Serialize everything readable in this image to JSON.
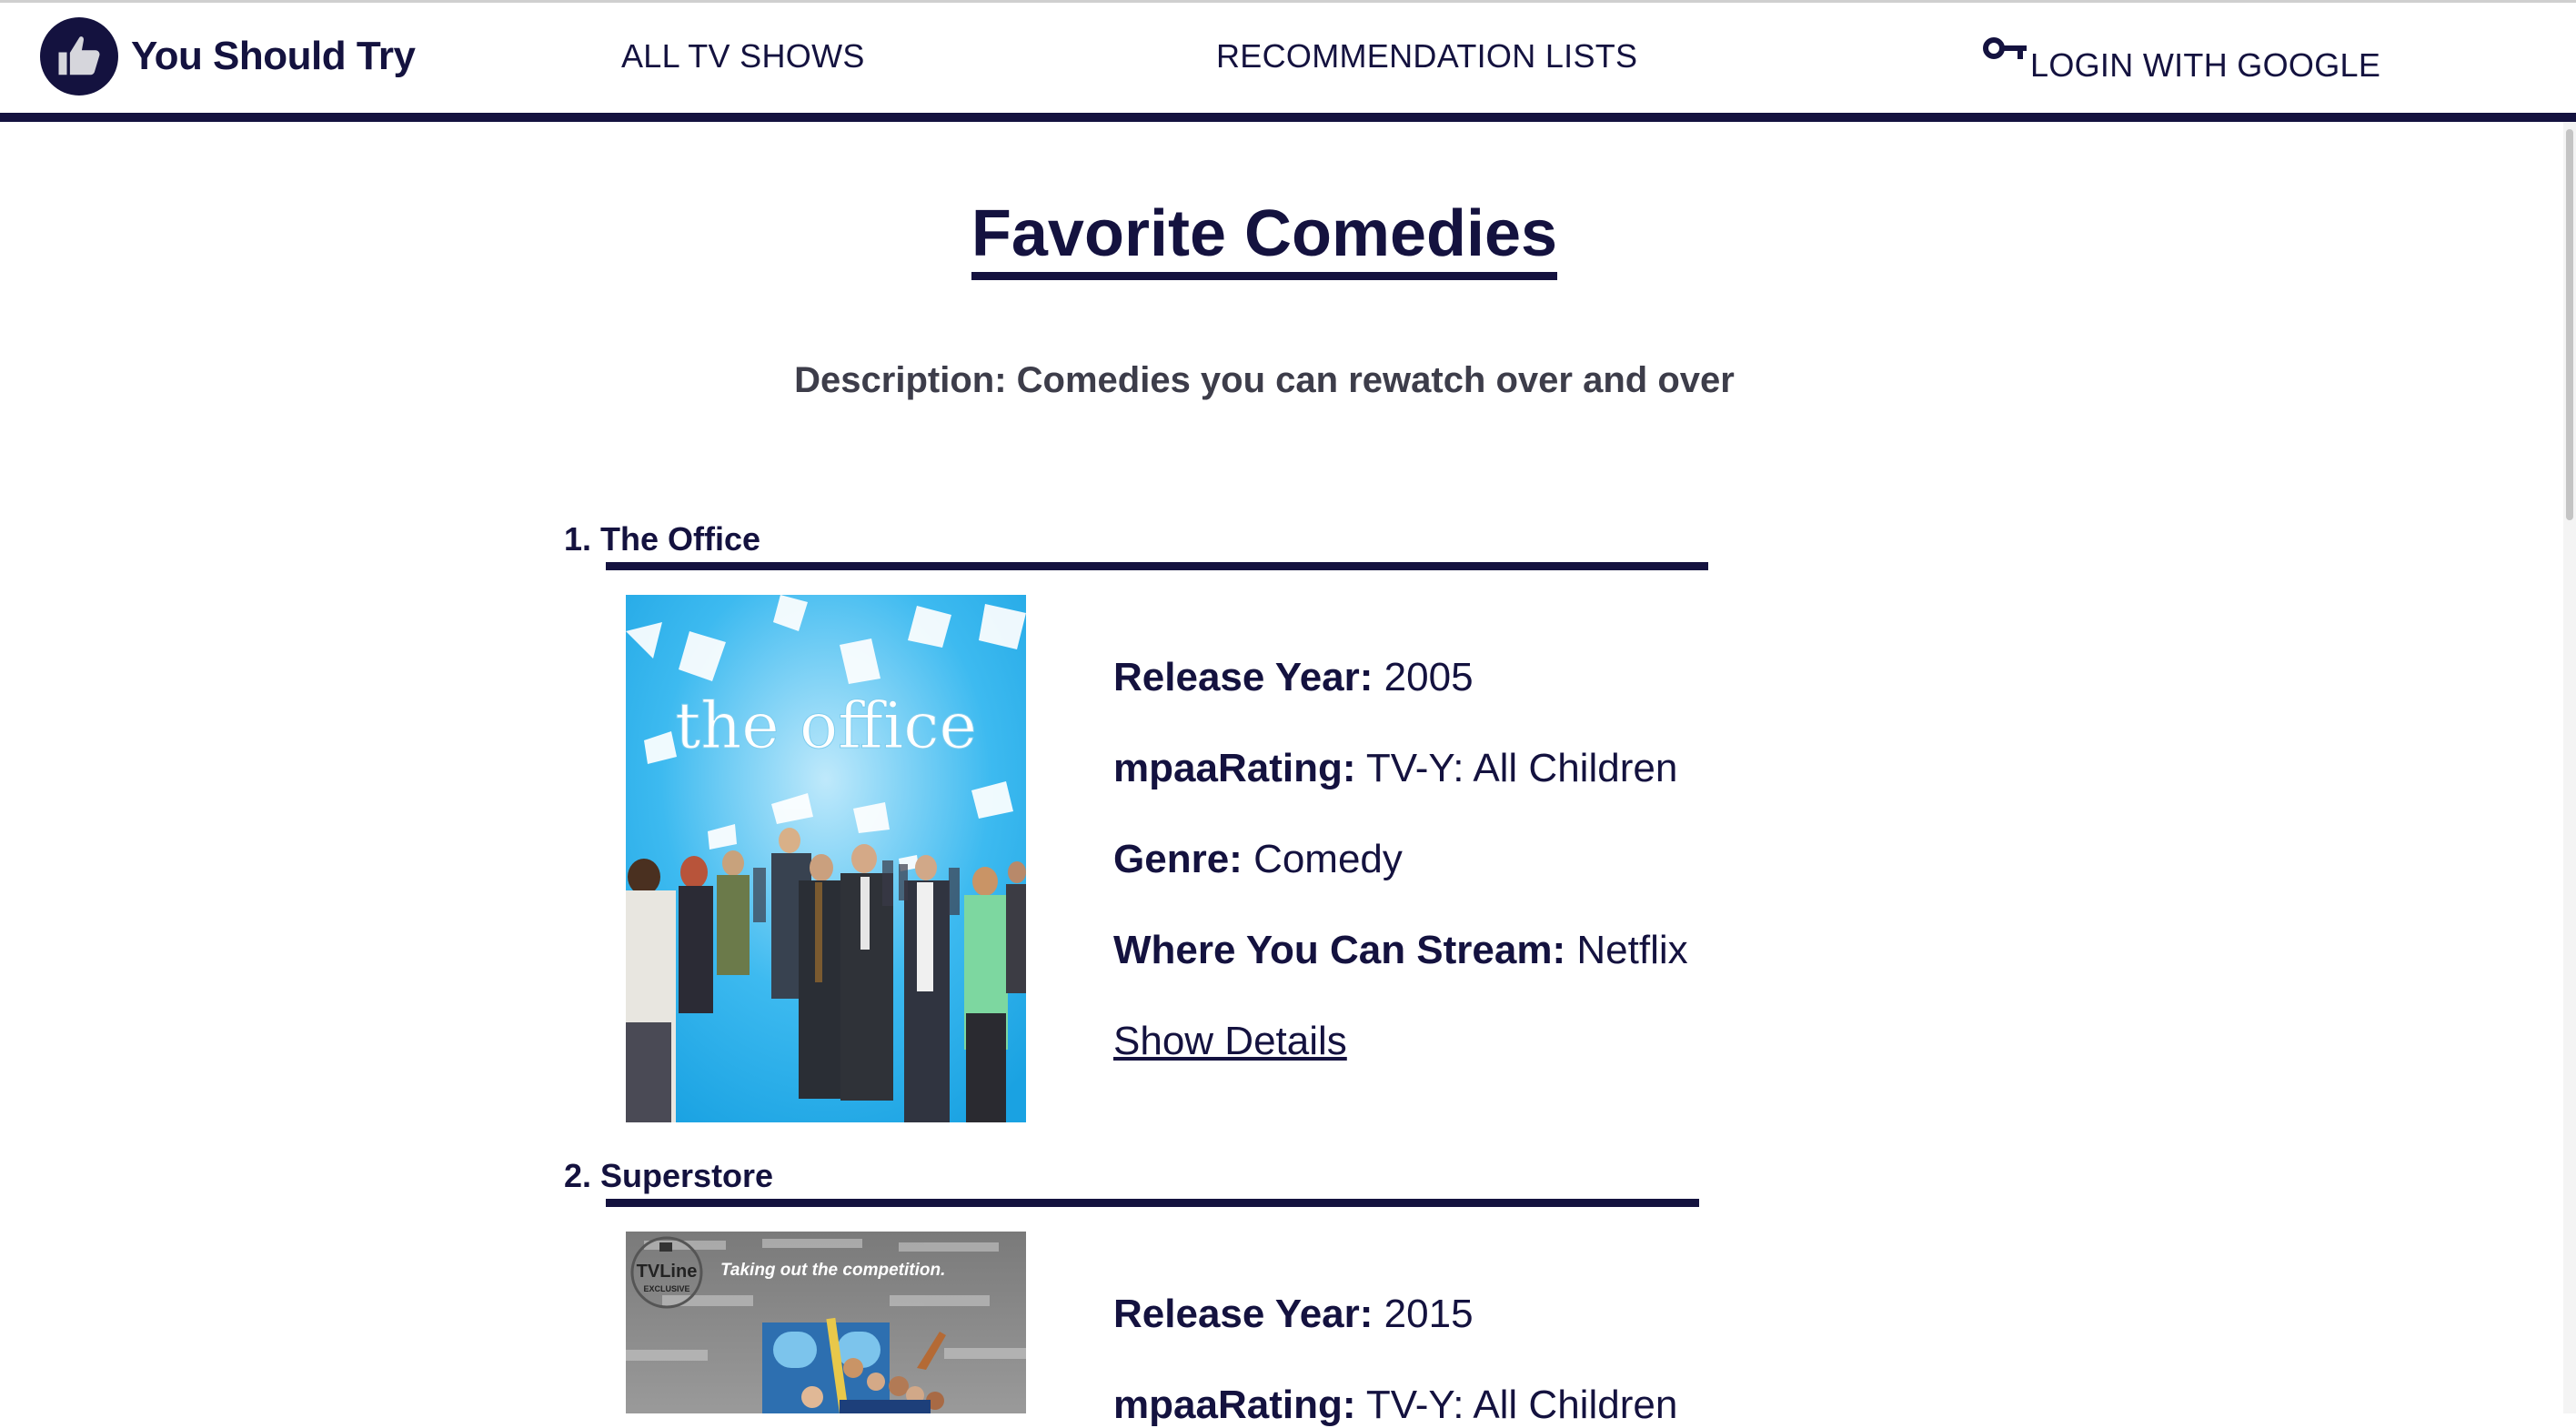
{
  "app": {
    "brand_name": "You Should Try"
  },
  "nav": {
    "all_shows": "ALL TV SHOWS",
    "recommendation_lists": "RECOMMENDATION LISTS",
    "login": "LOGIN WITH GOOGLE"
  },
  "page": {
    "title": "Favorite Comedies",
    "description": "Description: Comedies you can rewatch over and over"
  },
  "labels": {
    "release_year": "Release Year:",
    "mpaa_rating": "mpaaRating:",
    "genre": "Genre:",
    "stream": "Where You Can Stream:",
    "show_details": "Show Details"
  },
  "shows": [
    {
      "heading": "1. The Office",
      "poster_title": "the office",
      "release_year": "2005",
      "mpaa_rating": "TV-Y: All Children",
      "genre": "Comedy",
      "stream": "Netflix"
    },
    {
      "heading": "2. Superstore",
      "poster_badge": "TVLine",
      "poster_badge_sub": "EXCLUSIVE",
      "poster_tagline": "Taking out the competition.",
      "release_year": "2015",
      "mpaa_rating": "TV-Y: All Children"
    }
  ],
  "colors": {
    "primary": "#14123f",
    "description": "#3d3d4a",
    "office_sky": "#31b6ea",
    "superstore_bg": "#8a8a8a"
  },
  "icons": [
    "thumbs-up-icon",
    "key-icon"
  ]
}
